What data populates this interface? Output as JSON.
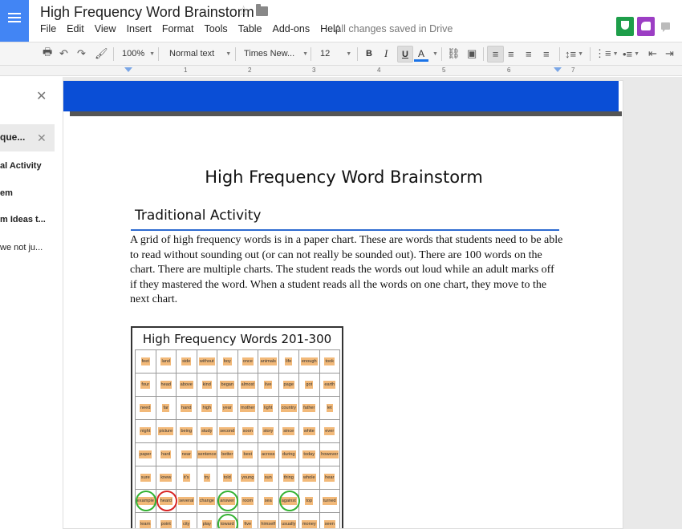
{
  "header": {
    "title": "High Frequency Word Brainstorm",
    "menus": [
      "File",
      "Edit",
      "View",
      "Insert",
      "Format",
      "Tools",
      "Table",
      "Add-ons",
      "Help"
    ],
    "save_status": "All changes saved in Drive"
  },
  "toolbar": {
    "zoom": "100%",
    "style": "Normal text",
    "font": "Times New...",
    "size": "12",
    "bold": "B",
    "italic": "I",
    "underline": "U",
    "text_color": "A"
  },
  "ruler": {
    "marks": [
      "1",
      "2",
      "3",
      "4",
      "5",
      "6",
      "7"
    ]
  },
  "outline": {
    "items": [
      {
        "label": "que...",
        "active": true
      },
      {
        "label": "al Activity"
      },
      {
        "label": "em"
      },
      {
        "label": "m Ideas t..."
      },
      {
        "label": "we not ju..."
      }
    ]
  },
  "document": {
    "heading": "High Frequency Word Brainstorm",
    "section_heading": "Traditional Activity",
    "paragraph": "A grid of high frequency words is in a paper chart. These are words that students need to be able to read without sounding out (or can not really be sounded out). There are 100 words on the chart. There are multiple charts. The student reads the words out loud while an adult marks off if they mastered the word. When a student reads all the words on one chart, they move to the next chart.",
    "chart_title": "High Frequency Words 201-300",
    "words": [
      [
        "feet",
        "land",
        "side",
        "without",
        "boy",
        "once",
        "animals",
        "life",
        "enough",
        "took"
      ],
      [
        "four",
        "head",
        "above",
        "kind",
        "began",
        "almost",
        "live",
        "page",
        "got",
        "earth"
      ],
      [
        "need",
        "far",
        "hand",
        "high",
        "year",
        "mother",
        "light",
        "country",
        "father",
        "let"
      ],
      [
        "night",
        "picture",
        "being",
        "study",
        "second",
        "soon",
        "story",
        "since",
        "white",
        "ever"
      ],
      [
        "paper",
        "hard",
        "near",
        "sentence",
        "better",
        "best",
        "across",
        "during",
        "today",
        "however"
      ],
      [
        "sure",
        "knew",
        "it's",
        "try",
        "told",
        "young",
        "sun",
        "thing",
        "whole",
        "hear"
      ],
      [
        "example",
        "heard",
        "several",
        "change",
        "answer",
        "room",
        "sea",
        "against",
        "top",
        "turned"
      ],
      [
        "learn",
        "point",
        "city",
        "play",
        "toward",
        "five",
        "himself",
        "usually",
        "money",
        "seen"
      ]
    ],
    "circled_green": [
      [
        6,
        0
      ],
      [
        6,
        4
      ],
      [
        6,
        7
      ],
      [
        7,
        4
      ]
    ],
    "circled_red": [
      [
        6,
        1
      ]
    ]
  },
  "colors": {
    "docs_blue": "#4285f4",
    "banner_blue": "#0a4ed6",
    "rule_blue": "#2e6bd0",
    "highlight_orange": "#f2b979",
    "circle_green": "#34b233",
    "circle_red": "#d82525"
  }
}
